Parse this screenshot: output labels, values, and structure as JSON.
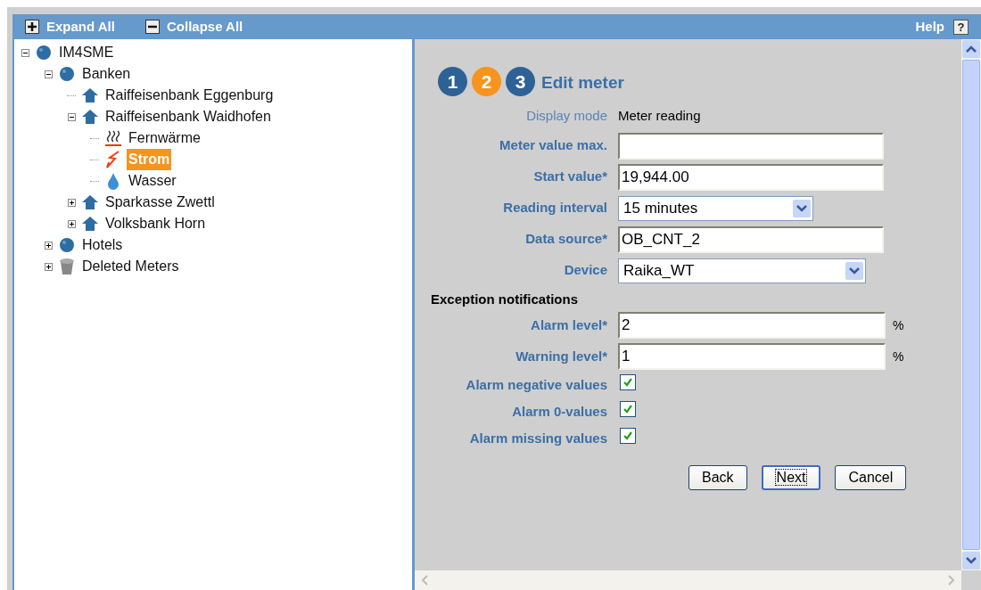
{
  "toolbar": {
    "expand_all": "Expand All",
    "collapse_all": "Collapse All",
    "help": "Help",
    "help_icon": "?"
  },
  "tree": [
    {
      "label": "IM4SME",
      "kind": "globe",
      "expanded": true,
      "selected": false,
      "children": [
        {
          "label": "Banken",
          "kind": "globe",
          "expanded": true,
          "selected": false,
          "children": [
            {
              "label": "Raiffeisenbank Eggenburg",
              "kind": "house",
              "selected": false
            },
            {
              "label": "Raiffeisenbank Waidhofen",
              "kind": "house",
              "expanded": true,
              "selected": false,
              "children": [
                {
                  "label": "Fernwärme",
                  "kind": "heat",
                  "selected": false
                },
                {
                  "label": "Strom",
                  "kind": "power",
                  "selected": true
                },
                {
                  "label": "Wasser",
                  "kind": "water",
                  "selected": false
                }
              ]
            },
            {
              "label": "Sparkasse Zwettl",
              "kind": "house",
              "expanded": false,
              "selected": false
            },
            {
              "label": "Volksbank Horn",
              "kind": "house",
              "expanded": false,
              "selected": false
            }
          ]
        },
        {
          "label": "Hotels",
          "kind": "globe",
          "expanded": false,
          "selected": false
        },
        {
          "label": "Deleted Meters",
          "kind": "trash",
          "expanded": false,
          "selected": false
        }
      ]
    }
  ],
  "steps": [
    {
      "label": "1",
      "selected": false
    },
    {
      "label": "2",
      "selected": true
    },
    {
      "label": "3",
      "selected": false
    }
  ],
  "title": "Edit meter",
  "display_mode": {
    "label": "Display mode",
    "value": "Meter reading"
  },
  "fields": [
    {
      "kind": "text",
      "label": "Meter value max."
    },
    {
      "kind": "text",
      "label": "Start value*",
      "value": "19,944.00"
    },
    {
      "kind": "select",
      "label": "Reading interval",
      "value": "15 minutes"
    },
    {
      "kind": "text",
      "label": "Data source*",
      "value": "OB_CNT_2"
    },
    {
      "kind": "select",
      "label": "Device",
      "value": "Raika_WT"
    }
  ],
  "exception_heading": "Exception notifications",
  "levels": [
    {
      "label": "Alarm level*",
      "value": "2",
      "unit": "%"
    },
    {
      "label": "Warning level*",
      "value": "1",
      "unit": "%"
    }
  ],
  "checks": [
    {
      "label": "Alarm negative values",
      "checked": true
    },
    {
      "label": "Alarm 0-values",
      "checked": true
    },
    {
      "label": "Alarm missing values",
      "checked": true
    }
  ],
  "buttons": [
    {
      "label": "Back",
      "focused": false
    },
    {
      "label": "Next",
      "focused": true
    },
    {
      "label": "Cancel",
      "focused": false
    }
  ]
}
